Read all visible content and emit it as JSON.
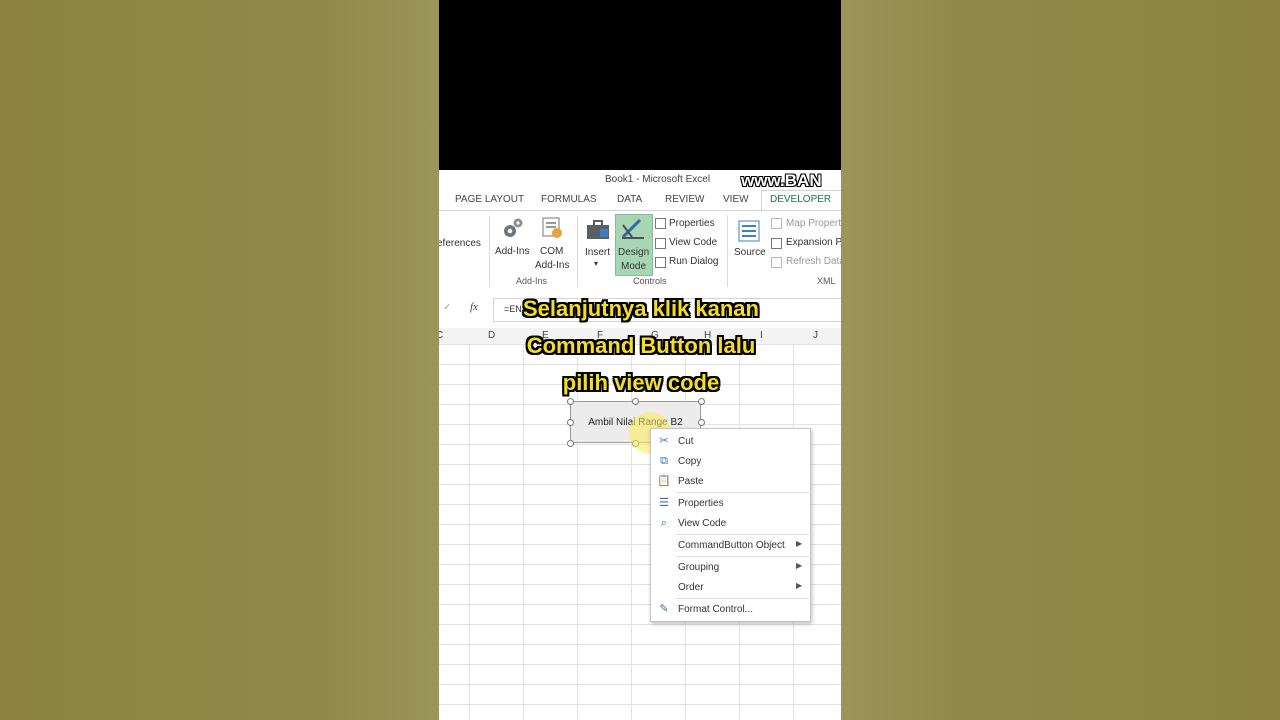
{
  "window": {
    "title": "Book1 - Microsoft Excel",
    "watermark": "www.BAN"
  },
  "tabs": [
    "PAGE LAYOUT",
    "FORMULAS",
    "DATA",
    "REVIEW",
    "VIEW",
    "DEVELOPER"
  ],
  "ribbon": {
    "references": "eferences",
    "addins": {
      "addins_label": "Add-Ins",
      "com_line1": "COM",
      "com_line2": "Add-Ins",
      "group": "Add-Ins"
    },
    "controls": {
      "insert": "Insert",
      "design_line1": "Design",
      "design_line2": "Mode",
      "properties": "Properties",
      "view_code": "View Code",
      "run_dialog": "Run Dialog",
      "group": "Controls"
    },
    "xml": {
      "source": "Source",
      "map_properties": "Map Propert",
      "expansion_packs": "Expansion Pa",
      "refresh_data": "Refresh Data",
      "group": "XML"
    }
  },
  "formula_bar": {
    "value": "=EN",
    "fx": "fx",
    "check": "✓"
  },
  "columns": [
    "C",
    "D",
    "E",
    "F",
    "G",
    "H",
    "I",
    "J"
  ],
  "command_button": {
    "label": "Ambil Nilai Range B2"
  },
  "context_menu": {
    "items": [
      {
        "label": "Cut",
        "icon": "scissors-icon"
      },
      {
        "label": "Copy",
        "icon": "copy-icon"
      },
      {
        "label": "Paste",
        "icon": "paste-icon"
      },
      {
        "label": "Properties",
        "icon": "properties-icon"
      },
      {
        "label": "View Code",
        "icon": "view-code-icon"
      },
      {
        "label": "CommandButton Object",
        "icon": ""
      },
      {
        "label": "Grouping",
        "icon": ""
      },
      {
        "label": "Order",
        "icon": ""
      },
      {
        "label": "Format Control...",
        "icon": "format-control-icon"
      }
    ]
  },
  "caption": {
    "line1": "Selanjutnya klik kanan",
    "line2": "Command Button lalu",
    "line3": "pilih view code"
  }
}
